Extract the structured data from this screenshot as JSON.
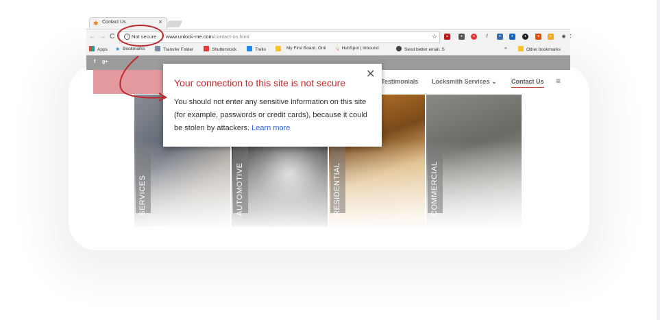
{
  "browser": {
    "tab_title": "Contact Us",
    "tab_close": "×",
    "security_label": "Not secure",
    "url_host": "www.unlock-me.com",
    "url_path": "/contact-us.html",
    "bookmarks": [
      {
        "label": "Apps",
        "color": "#4285f4"
      },
      {
        "label": "Bookmarks",
        "color": "#4a7bd0"
      },
      {
        "label": "Transfer Folder",
        "color": "#7b8ba3"
      },
      {
        "label": "Shutterstock",
        "color": "#e53935"
      },
      {
        "label": "Trello",
        "color": "#1e88e5"
      },
      {
        "label": "",
        "color": "#fbc02d"
      },
      {
        "label": "My First Board, Onli",
        "color": "#ffffff"
      },
      {
        "label": "HubSpot | Inbound",
        "color": "#ff7043"
      },
      {
        "label": "Send better email. S",
        "color": "#444444"
      },
      {
        "label": "»",
        "color": "#ffffff"
      },
      {
        "label": "Other bookmarks",
        "color": "#fbc02d"
      }
    ]
  },
  "site": {
    "social": [
      "f",
      "g+"
    ],
    "nav": [
      "Testimonials",
      "Locksmith Services",
      "Contact Us"
    ],
    "nav_chevron": "⌄",
    "menu_icon": "≡",
    "panels": [
      "SERVICES",
      "AUTOMOTIVE",
      "RESIDENTIAL",
      "COMMERCIAL"
    ]
  },
  "popup": {
    "title": "Your connection to this site is not secure",
    "body": "You should not enter any sensitive information on this site (for example, passwords or credit cards), because it could be stolen by attackers.",
    "link": "Learn more",
    "close": "✕"
  },
  "colors": {
    "warning_red": "#c3272b",
    "annotation_red": "#c0272d",
    "link_blue": "#3367d6"
  }
}
